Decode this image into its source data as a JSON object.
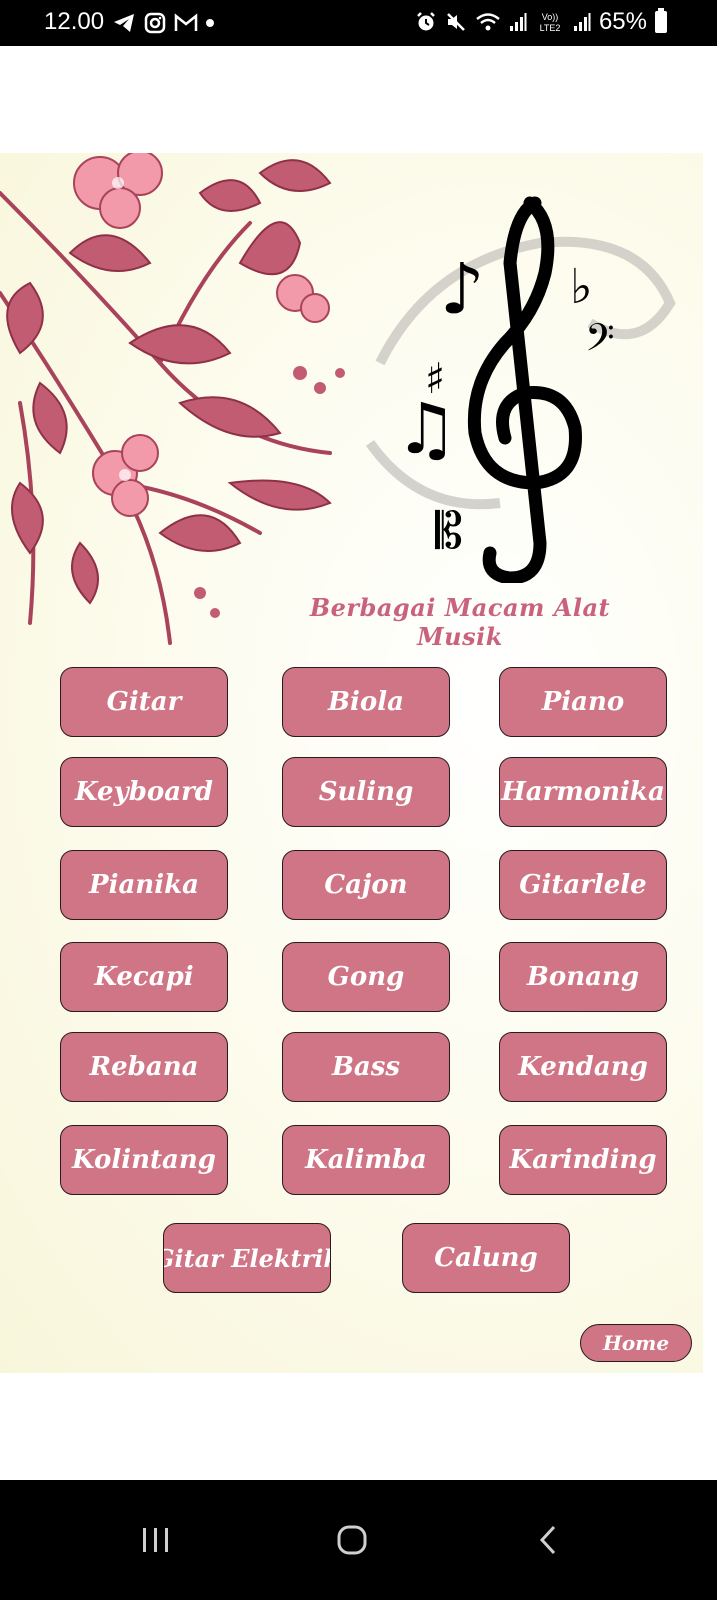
{
  "status_bar": {
    "time": "12.00",
    "battery": "65%",
    "icons": [
      "telegram-icon",
      "instagram-icon",
      "gmail-icon",
      "notification-dot",
      "alarm-icon",
      "mute-icon",
      "wifi-icon",
      "signal-icon",
      "volte-icon",
      "signal-icon",
      "battery-icon"
    ]
  },
  "app": {
    "title": "Berbagai Macam Alat Musik",
    "instruments": [
      "Gitar",
      "Biola",
      "Piano",
      "Keyboard",
      "Suling",
      "Harmonika",
      "Pianika",
      "Cajon",
      "Gitarlele",
      "Kecapi",
      "Gong",
      "Bonang",
      "Rebana",
      "Bass",
      "Kendang",
      "Kolintang",
      "Kalimba",
      "Karinding",
      "Gitar Elektrik",
      "Calung"
    ],
    "home_label": "Home",
    "colors": {
      "button_fill": "#cf7585",
      "title_text": "#c9627c",
      "floral": "#b94e66"
    }
  },
  "nav_bar": {
    "buttons": [
      "recent-apps",
      "home",
      "back"
    ]
  }
}
